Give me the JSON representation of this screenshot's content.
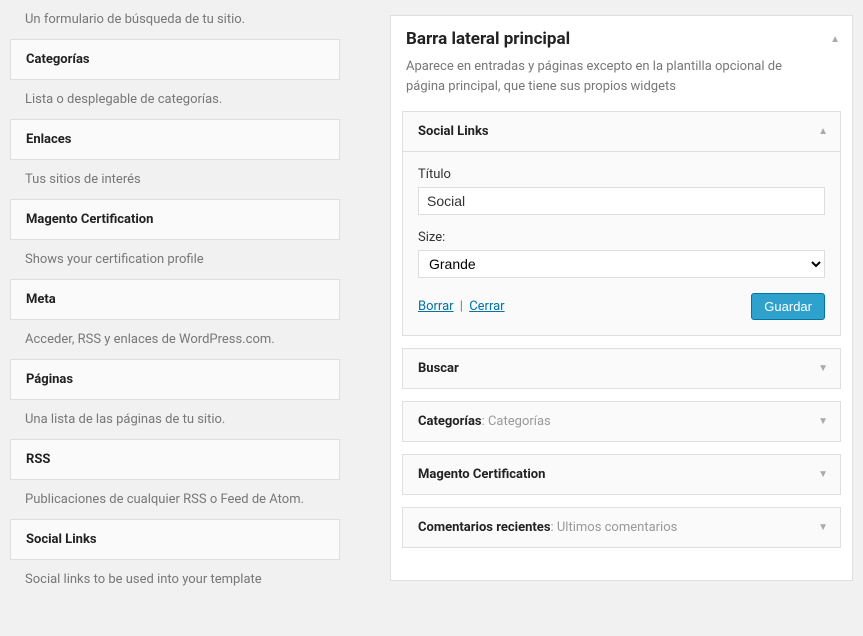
{
  "available_widgets": [
    {
      "title": "",
      "desc": "Un formulario de búsqueda de tu sitio."
    },
    {
      "title": "Categorías",
      "desc": "Lista o desplegable de categorías."
    },
    {
      "title": "Enlaces",
      "desc": "Tus sitios de interés"
    },
    {
      "title": "Magento Certification",
      "desc": "Shows your certification profile"
    },
    {
      "title": "Meta",
      "desc": "Acceder, RSS y enlaces de WordPress.com."
    },
    {
      "title": "Páginas",
      "desc": "Una lista de las páginas de tu sitio."
    },
    {
      "title": "RSS",
      "desc": "Publicaciones de cualquier RSS o Feed de Atom."
    },
    {
      "title": "Social Links",
      "desc": "Social links to be used into your template"
    }
  ],
  "sidebar": {
    "title": "Barra lateral principal",
    "desc": "Aparece en entradas y páginas excepto en la plantilla opcional de página principal, que tiene sus propios widgets",
    "widgets": [
      {
        "name": "Social Links",
        "expanded": true,
        "form": {
          "title_label": "Título",
          "title_value": "Social",
          "size_label": "Size:",
          "size_value": "Grande",
          "delete": "Borrar",
          "close": "Cerrar",
          "save": "Guardar"
        }
      },
      {
        "name": "Buscar",
        "subtitle": ""
      },
      {
        "name": "Categorías",
        "subtitle": "Categorías"
      },
      {
        "name": "Magento Certification",
        "subtitle": ""
      },
      {
        "name": "Comentarios recientes",
        "subtitle": "Ultimos comentarios"
      }
    ]
  },
  "subtitle_sep": ": "
}
